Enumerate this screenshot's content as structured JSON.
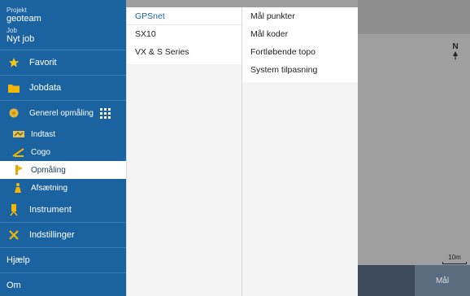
{
  "sidebar": {
    "project_label": "Projekt",
    "project_value": "geoteam",
    "job_label": "Job",
    "job_value": "Nyt job",
    "items": [
      {
        "label": "Favorit",
        "icon": "star-icon"
      },
      {
        "label": "Jobdata",
        "icon": "folder-icon"
      },
      {
        "label": "Generel opmåling",
        "icon": "survey-icon"
      },
      {
        "label": "Indtast",
        "icon": "keyin-icon"
      },
      {
        "label": "Cogo",
        "icon": "cogo-icon"
      },
      {
        "label": "Opmåling",
        "icon": "measure-icon"
      },
      {
        "label": "Afsætning",
        "icon": "stakeout-icon"
      },
      {
        "label": "Instrument",
        "icon": "instrument-icon"
      },
      {
        "label": "Indstillinger",
        "icon": "settings-icon"
      },
      {
        "label": "Hjælp"
      },
      {
        "label": "Om"
      }
    ]
  },
  "column2": {
    "items": [
      "GPSnet",
      "SX10",
      "VX & S Series"
    ]
  },
  "column3": {
    "items": [
      "Mål punkter",
      "Mål koder",
      "Fortløbende topo",
      "System tilpasning"
    ]
  },
  "map": {
    "north_label": "N",
    "scale_label": "10m",
    "measure_button": "Mål"
  },
  "colors": {
    "sidebar_bg": "#1b63a0",
    "accent": "#1b63a0",
    "active_bg": "#ffffff"
  }
}
